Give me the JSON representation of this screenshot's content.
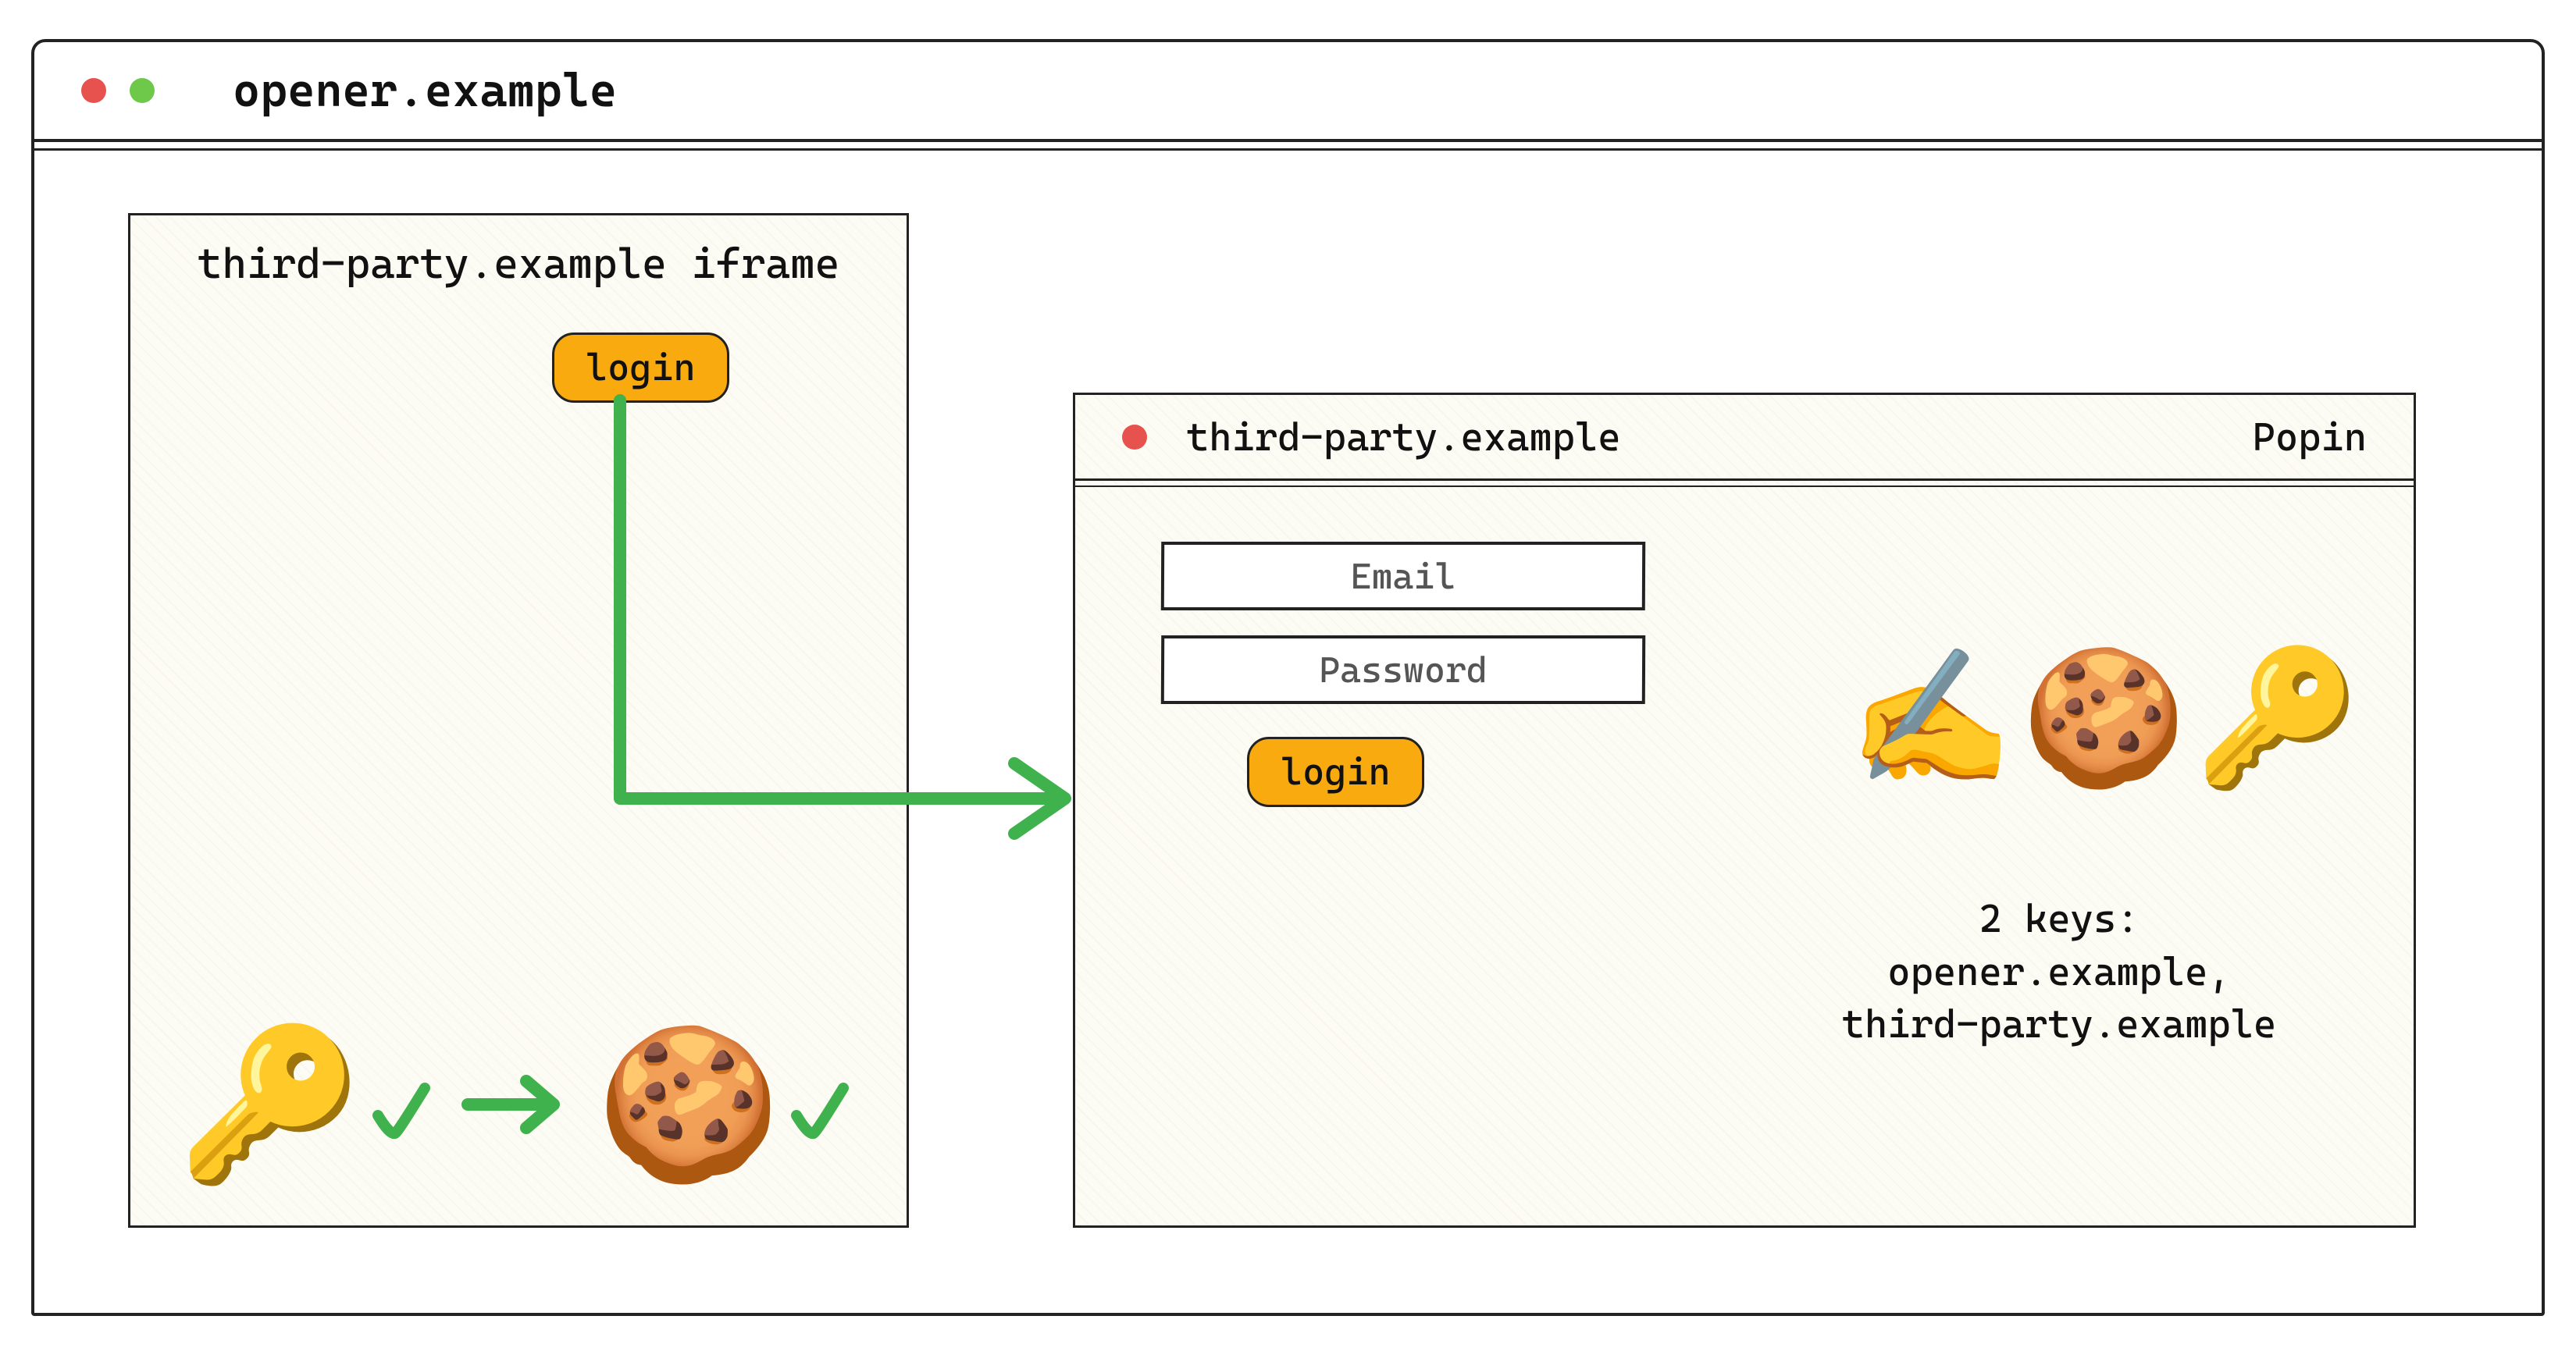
{
  "window": {
    "title": "opener.example"
  },
  "iframe": {
    "title": "third-party.example iframe",
    "login_label": "login"
  },
  "popin": {
    "title": "third-party.example",
    "type_label": "Popin",
    "email_placeholder": "Email",
    "password_placeholder": "Password",
    "login_label": "login",
    "keys_heading": "2 keys:",
    "keys_line1": "opener.example,",
    "keys_line2": "third-party.example"
  },
  "icons": {
    "key": "🔑",
    "cookie": "🍪",
    "write": "✍️"
  },
  "arrow_color": "#3fb24d"
}
